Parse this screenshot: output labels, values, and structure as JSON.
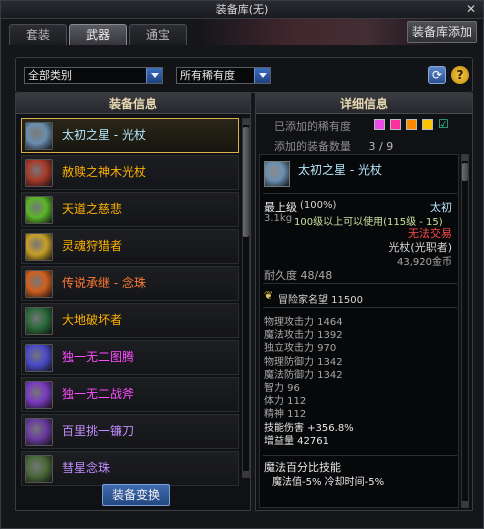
{
  "window": {
    "title": "装备库(无)",
    "close_glyph": "✕"
  },
  "tabs": [
    {
      "label": "套装"
    },
    {
      "label": "武器"
    },
    {
      "label": "通宝"
    }
  ],
  "store_add_button": "装备库添加",
  "filters": {
    "category": "全部类别",
    "rarity": "所有稀有度"
  },
  "left_panel": {
    "header": "装备信息",
    "items": [
      {
        "name": "太初之星 - 光杖",
        "color": "#b4e7ff",
        "icon_color": "#6b8fb0"
      },
      {
        "name": "赦赎之神木光杖",
        "color": "#ffb200",
        "icon_color": "#a83a2a"
      },
      {
        "name": "天道之慈悲",
        "color": "#ffb200",
        "icon_color": "#5bb52a"
      },
      {
        "name": "灵魂狩猎者",
        "color": "#ffb200",
        "icon_color": "#c8a028"
      },
      {
        "name": "传说承继 - 念珠",
        "color": "#ff7a32",
        "icon_color": "#d06020"
      },
      {
        "name": "大地破坏者",
        "color": "#ffb200",
        "icon_color": "#2a6a3a"
      },
      {
        "name": "独一无二图腾",
        "color": "#ff4cff",
        "icon_color": "#4a4ac8"
      },
      {
        "name": "独一无二战斧",
        "color": "#ff4cff",
        "icon_color": "#7a3ac0"
      },
      {
        "name": "百里挑一镰刀",
        "color": "#c28dff",
        "icon_color": "#6a3aa0"
      },
      {
        "name": "彗星念珠",
        "color": "#c28dff",
        "icon_color": "#4a6a3a"
      }
    ],
    "equip_button": "装备变换"
  },
  "right_panel": {
    "header": "详细信息",
    "rarity_label": "已添加的稀有度",
    "rarity_colors": [
      "#e94ce9",
      "#ff2ea0",
      "#ff8a00",
      "#ffc400"
    ],
    "count_label": "添加的装备数量",
    "count_value": "3 / 9"
  },
  "detail": {
    "name": "太初之星 - 光杖",
    "grade": "最上级",
    "grade_pct": "(100%)",
    "rarity_text": "太初",
    "weight": "3.1kg",
    "level_req": "100级以上可以使用(115级 - 15)",
    "trade": "无法交易",
    "class": "光杖(光职者)",
    "price": "43,920金币",
    "durability": "耐久度 48/48",
    "fame": "冒险家名望 11500",
    "stats": [
      "物理攻击力 1464",
      "魔法攻击力 1392",
      "独立攻击力 970",
      "物理防御力 1342",
      "魔法防御力 1342",
      "智力 96",
      "体力 112",
      "精神 112",
      "技能伤害 +356.8%",
      "增益量 42761"
    ],
    "skill_title": "魔法百分比技能",
    "skill_line": "魔法值-5% 冷却时间-5%"
  }
}
